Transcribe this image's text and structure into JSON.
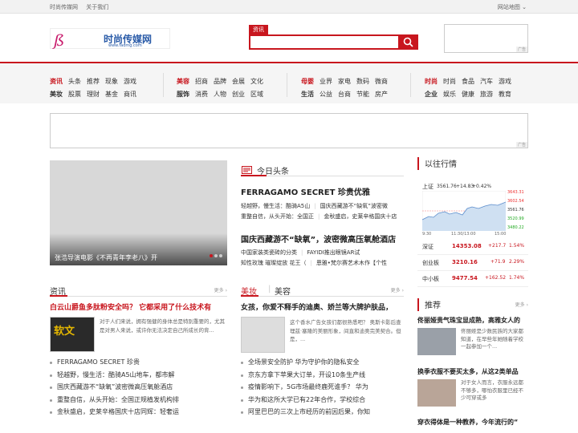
{
  "topbar": {
    "links": [
      "时尚传媒网",
      "关于我们"
    ],
    "sitemap": "网站地图"
  },
  "logo": {
    "text": "时尚传媒网",
    "url": "www.fadmg.com"
  },
  "search": {
    "tab": "资讯",
    "placeholder": ""
  },
  "ad": {
    "tag": "广告"
  },
  "nav": {
    "groups": [
      {
        "rows": [
          [
            "资讯",
            "头条",
            "推荐",
            "现象",
            "游戏"
          ],
          [
            "美妆",
            "股票",
            "理财",
            "基金",
            "商讯"
          ]
        ]
      },
      {
        "rows": [
          [
            "美容",
            "招商",
            "品牌",
            "会展",
            "文化"
          ],
          [
            "服饰",
            "消费",
            "人物",
            "创业",
            "区域"
          ]
        ]
      },
      {
        "rows": [
          [
            "母婴",
            "业界",
            "家电",
            "数码",
            "微商"
          ],
          [
            "生活",
            "公益",
            "台商",
            "节能",
            "房产"
          ]
        ]
      },
      {
        "rows": [
          [
            "时尚",
            "时尚",
            "食品",
            "汽车",
            "游戏"
          ],
          [
            "企业",
            "娱乐",
            "健康",
            "旅游",
            "教育"
          ]
        ]
      }
    ]
  },
  "slider": {
    "caption": "张浩导演电影《不再青年李老八》开"
  },
  "headlines": {
    "title": "今日头条",
    "items": [
      {
        "title": "FERRAGAMO SECRET 珍贵优雅",
        "subs": [
          [
            "轻越野，慢生活：酷骑A5山",
            "国庆西藏游不“缺氧”波密微"
          ],
          [
            "重整自信，从头开始：全国正",
            "金秋盛启，史莱辛格国庆十店"
          ]
        ]
      },
      {
        "title": "国庆西藏游不“缺氧”，波密微高压氧舱酒店",
        "subs": [
          [
            "中国家装类瓷砖的分类",
            "FAYIDI推出眼镜AR试"
          ],
          [
            "知性玫瑰 璀璨绽放 花王（",
            "恩雅•梵尔赛艺术木作【个性"
          ]
        ]
      }
    ]
  },
  "market": {
    "title": "以往行情",
    "index_name": "上证",
    "index_value": "3561.76",
    "index_change": "+14.83",
    "index_pct": "+0.42%",
    "y_ticks": [
      "3643.31",
      "3602.54",
      "3561.76",
      "3520.99",
      "3480.22"
    ],
    "x_ticks": [
      "9:30",
      "11:30/13:00",
      "15:00"
    ],
    "rows": [
      {
        "name": "深证",
        "value": "14353.08",
        "change": "+217.7",
        "pct": "1.54%"
      },
      {
        "name": "创业板",
        "value": "3210.16",
        "change": "+71.9",
        "pct": "2.29%"
      },
      {
        "name": "中小板",
        "value": "9477.54",
        "change": "+162.52",
        "pct": "1.74%"
      }
    ]
  },
  "news": {
    "title": "资讯",
    "more": "更多",
    "lead": "白云山爵鱼多肽粉安全吗？ 它都采用了什么技术有",
    "desc": "对于人们来说，拥有强健的身体总是特别重要的，尤其是对男人来说，或许你无法决定自己所成长的背...",
    "thumb_text": "软文",
    "items": [
      "FERRAGAMO SECRET 珍贵",
      "轻越野，慢生活：酷骑A5山地车，都市解",
      "国庆西藏游不“缺氧”波密微高压氧舱酒店",
      "重整自信，从头开始：全国正规植发机构排",
      "金秋盛启，史莱辛格国庆十店同辉：轻奢运"
    ]
  },
  "beauty": {
    "tabs": [
      "美妆",
      "美容"
    ],
    "more": "更多",
    "lead": "女孩，你爱不释手的迪奥、娇兰等大牌护肤品，",
    "desc": "这个香水广告女孩们都很熟悉吧？ 奥斯卡影后查理兹·塞隆的美丽形象，间直和迪奥完美契合。但是，...",
    "items": [
      "全场景安全防护 华为守护你的隐私安全",
      "京东方拿下苹果大订单，开设10条生产线",
      "疫情影响下，5G市场最终鹿死谁手？ 华为",
      "华为和这所大学已有22年合作，学校综合",
      "阿里巴巴的三次上市经历的前因后果，你知"
    ]
  },
  "recommend": {
    "title": "推荐",
    "more": "更多",
    "items": [
      {
        "title": "佟丽娅贵气珠宝显成熟，高雅女人的",
        "desc": "佟丽娅是少数民族的大家都知道，在早些年她随着学校一起参加一个..."
      },
      {
        "title": "换季衣服不要买太多，从这2类单品",
        "desc": "对于女人而言，衣服永远都不够多，哪怕衣服里已经不少可穿或多"
      },
      {
        "title": "穿衣得体是一种教养，今年流行的“"
      }
    ]
  }
}
